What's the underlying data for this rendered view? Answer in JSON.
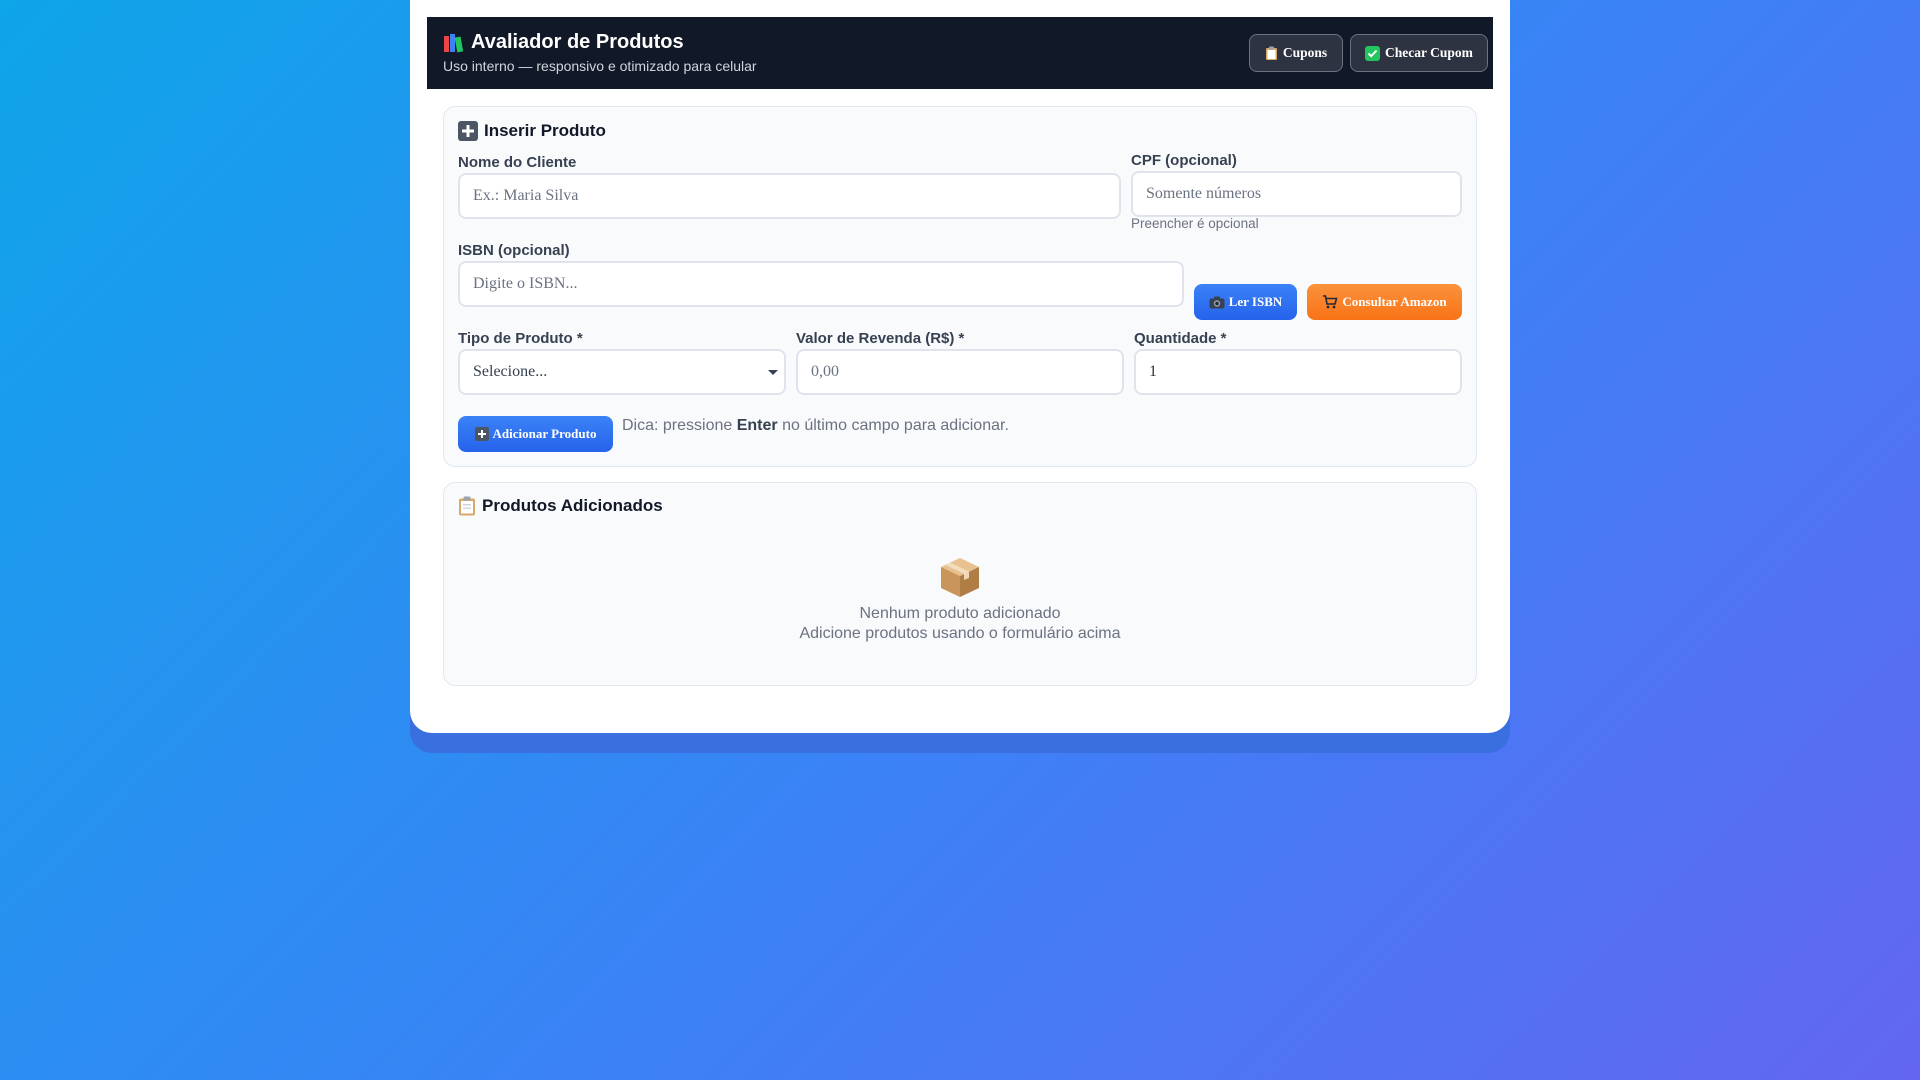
{
  "header": {
    "icon": "books-icon",
    "title": "Avaliador de Produtos",
    "subtitle": "Uso interno — responsivo e otimizado para celular",
    "cupons_label": "Cupons",
    "checar_label": "Checar Cupom"
  },
  "form": {
    "title": "Inserir Produto",
    "cliente_label": "Nome do Cliente",
    "cliente_placeholder": "Ex.: Maria Silva",
    "cpf_label": "CPF (opcional)",
    "cpf_placeholder": "Somente números",
    "cpf_hint": "Preencher é opcional",
    "isbn_label": "ISBN (opcional)",
    "isbn_placeholder": "Digite o ISBN...",
    "ler_isbn_label": "Ler ISBN",
    "amazon_label": "Consultar Amazon",
    "tipo_label": "Tipo de Produto *",
    "tipo_selected": "Selecione...",
    "valor_label": "Valor de Revenda (R$) *",
    "valor_placeholder": "0,00",
    "qtd_label": "Quantidade *",
    "qtd_value": "1",
    "add_label": "Adicionar Produto",
    "dica_pre": "Dica: pressione",
    "dica_key": "Enter",
    "dica_post": "no último campo para adicionar."
  },
  "list": {
    "title": "Produtos Adicionados",
    "empty_title": "Nenhum produto adicionado",
    "empty_sub": "Adicione produtos usando o formulário acima"
  },
  "colors": {
    "header_bg": "#111827",
    "primary": "#3b82f6",
    "amazon": "#f97316"
  }
}
